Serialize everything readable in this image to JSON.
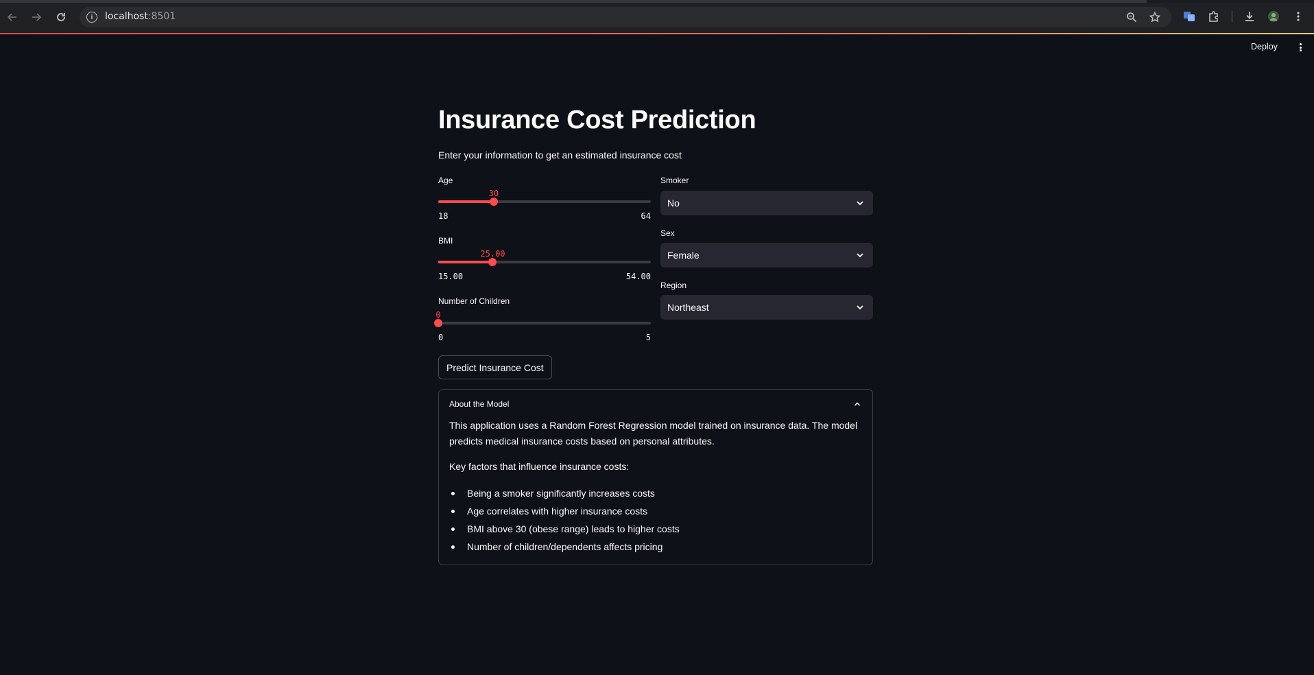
{
  "browser": {
    "url_host": "localhost",
    "url_port": ":8501"
  },
  "header": {
    "deploy_label": "Deploy"
  },
  "app": {
    "title": "Insurance Cost Prediction",
    "subtitle": "Enter your information to get an estimated insurance cost",
    "age": {
      "label": "Age",
      "value": "30",
      "min": "18",
      "max": "64",
      "fraction": 0.2609
    },
    "bmi": {
      "label": "BMI",
      "value": "25.00",
      "min": "15.00",
      "max": "54.00",
      "fraction": 0.2564
    },
    "children": {
      "label": "Number of Children",
      "value": "0",
      "min": "0",
      "max": "5",
      "fraction": 0.0
    },
    "smoker": {
      "label": "Smoker",
      "value": "No"
    },
    "sex": {
      "label": "Sex",
      "value": "Female"
    },
    "region": {
      "label": "Region",
      "value": "Northeast"
    },
    "predict_label": "Predict Insurance Cost",
    "about": {
      "title": "About the Model",
      "description": "This application uses a Random Forest Regression model trained on insurance data. The model predicts medical insurance costs based on personal attributes.",
      "factors_heading": "Key factors that influence insurance costs:",
      "factors": [
        "Being a smoker significantly increases costs",
        "Age correlates with higher insurance costs",
        "BMI above 30 (obese range) leads to higher costs",
        "Number of children/dependents affects pricing"
      ]
    }
  },
  "colors": {
    "accent": "#ff4b4b",
    "background": "#0e1117",
    "select_bg": "#262730"
  }
}
